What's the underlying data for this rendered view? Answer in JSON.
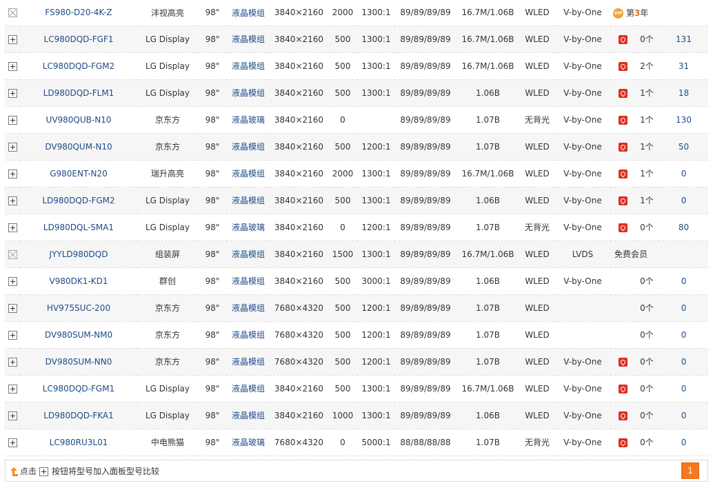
{
  "colors": {
    "link": "#1e4a86",
    "pdf": "#e02d20",
    "accent": "#f47920",
    "vip": "#f1a23a"
  },
  "rows": [
    {
      "toggle": "disabled",
      "model": "FS980-D20-4K-Z",
      "brand": "沣视高亮",
      "size": "98\"",
      "type": "液晶模组",
      "resolution": "3840×2160",
      "brightness": "2000",
      "contrast": "1300:1",
      "angle": "89/89/89/89",
      "colors": "16.7M/1.06B",
      "backlight": "WLED",
      "interface": "V-by-One",
      "pdf": false,
      "vip": true,
      "vip_badge": "VIP",
      "rank_prefix": "第",
      "rank_num": "3",
      "rank_suffix": "年",
      "count": "",
      "link": ""
    },
    {
      "toggle": "plus",
      "model": "LC980DQD-FGF1",
      "brand": "LG Display",
      "size": "98\"",
      "type": "液晶模组",
      "resolution": "3840×2160",
      "brightness": "500",
      "contrast": "1300:1",
      "angle": "89/89/89/89",
      "colors": "16.7M/1.06B",
      "backlight": "WLED",
      "interface": "V-by-One",
      "pdf": true,
      "count": "0个",
      "link": "131"
    },
    {
      "toggle": "plus",
      "model": "LC980DQD-FGM2",
      "brand": "LG Display",
      "size": "98\"",
      "type": "液晶模组",
      "resolution": "3840×2160",
      "brightness": "500",
      "contrast": "1300:1",
      "angle": "89/89/89/89",
      "colors": "16.7M/1.06B",
      "backlight": "WLED",
      "interface": "V-by-One",
      "pdf": true,
      "count": "2个",
      "link": "31"
    },
    {
      "toggle": "plus",
      "model": "LD980DQD-FLM1",
      "brand": "LG Display",
      "size": "98\"",
      "type": "液晶模组",
      "resolution": "3840×2160",
      "brightness": "500",
      "contrast": "1300:1",
      "angle": "89/89/89/89",
      "colors": "1.06B",
      "backlight": "WLED",
      "interface": "V-by-One",
      "pdf": true,
      "count": "1个",
      "link": "18"
    },
    {
      "toggle": "plus",
      "model": "UV980QUB-N10",
      "brand": "京东方",
      "size": "98\"",
      "type": "液晶玻璃",
      "resolution": "3840×2160",
      "brightness": "0",
      "contrast": "",
      "angle": "89/89/89/89",
      "colors": "1.07B",
      "backlight": "无背光",
      "interface": "V-by-One",
      "pdf": true,
      "count": "1个",
      "link": "130"
    },
    {
      "toggle": "plus",
      "model": "DV980QUM-N10",
      "brand": "京东方",
      "size": "98\"",
      "type": "液晶模组",
      "resolution": "3840×2160",
      "brightness": "500",
      "contrast": "1200:1",
      "angle": "89/89/89/89",
      "colors": "1.07B",
      "backlight": "WLED",
      "interface": "V-by-One",
      "pdf": true,
      "count": "1个",
      "link": "50"
    },
    {
      "toggle": "plus",
      "model": "G980ENT-N20",
      "brand": "瑞升高亮",
      "size": "98\"",
      "type": "液晶模组",
      "resolution": "3840×2160",
      "brightness": "2000",
      "contrast": "1300:1",
      "angle": "89/89/89/89",
      "colors": "16.7M/1.06B",
      "backlight": "WLED",
      "interface": "V-by-One",
      "pdf": true,
      "count": "1个",
      "link": "0"
    },
    {
      "toggle": "plus",
      "model": "LD980DQD-FGM2",
      "brand": "LG Display",
      "size": "98\"",
      "type": "液晶模组",
      "resolution": "3840×2160",
      "brightness": "500",
      "contrast": "1300:1",
      "angle": "89/89/89/89",
      "colors": "1.06B",
      "backlight": "WLED",
      "interface": "V-by-One",
      "pdf": true,
      "count": "1个",
      "link": "0"
    },
    {
      "toggle": "plus",
      "model": "LD980DQL-SMA1",
      "brand": "LG Display",
      "size": "98\"",
      "type": "液晶玻璃",
      "resolution": "3840×2160",
      "brightness": "0",
      "contrast": "1200:1",
      "angle": "89/89/89/89",
      "colors": "1.07B",
      "backlight": "无背光",
      "interface": "V-by-One",
      "pdf": true,
      "count": "0个",
      "link": "80"
    },
    {
      "toggle": "disabled",
      "model": "JYYLD980DQD",
      "brand": "组装屏",
      "size": "98\"",
      "type": "液晶模组",
      "resolution": "3840×2160",
      "brightness": "1500",
      "contrast": "1300:1",
      "angle": "89/89/89/89",
      "colors": "16.7M/1.06B",
      "backlight": "WLED",
      "interface": "LVDS",
      "pdf": false,
      "free": "免费会员",
      "count": "",
      "link": ""
    },
    {
      "toggle": "plus",
      "model": "V980DK1-KD1",
      "brand": "群创",
      "size": "98\"",
      "type": "液晶模组",
      "resolution": "3840×2160",
      "brightness": "500",
      "contrast": "3000:1",
      "angle": "89/89/89/89",
      "colors": "1.06B",
      "backlight": "WLED",
      "interface": "V-by-One",
      "pdf": false,
      "count": "0个",
      "link": "0"
    },
    {
      "toggle": "plus",
      "model": "HV975SUC-200",
      "brand": "京东方",
      "size": "98\"",
      "type": "液晶模组",
      "resolution": "7680×4320",
      "brightness": "500",
      "contrast": "1200:1",
      "angle": "89/89/89/89",
      "colors": "1.07B",
      "backlight": "WLED",
      "interface": "",
      "pdf": false,
      "count": "0个",
      "link": "0"
    },
    {
      "toggle": "plus",
      "model": "DV980SUM-NM0",
      "brand": "京东方",
      "size": "98\"",
      "type": "液晶模组",
      "resolution": "7680×4320",
      "brightness": "500",
      "contrast": "1200:1",
      "angle": "89/89/89/89",
      "colors": "1.07B",
      "backlight": "WLED",
      "interface": "",
      "pdf": false,
      "count": "0个",
      "link": "0"
    },
    {
      "toggle": "plus",
      "model": "DV980SUM-NN0",
      "brand": "京东方",
      "size": "98\"",
      "type": "液晶模组",
      "resolution": "7680×4320",
      "brightness": "500",
      "contrast": "1200:1",
      "angle": "89/89/89/89",
      "colors": "1.07B",
      "backlight": "WLED",
      "interface": "V-by-One",
      "pdf": true,
      "count": "0个",
      "link": "0"
    },
    {
      "toggle": "plus",
      "model": "LC980DQD-FGM1",
      "brand": "LG Display",
      "size": "98\"",
      "type": "液晶模组",
      "resolution": "3840×2160",
      "brightness": "500",
      "contrast": "1300:1",
      "angle": "89/89/89/89",
      "colors": "16.7M/1.06B",
      "backlight": "WLED",
      "interface": "V-by-One",
      "pdf": true,
      "count": "0个",
      "link": "0"
    },
    {
      "toggle": "plus",
      "model": "LD980DQD-FKA1",
      "brand": "LG Display",
      "size": "98\"",
      "type": "液晶模组",
      "resolution": "3840×2160",
      "brightness": "1000",
      "contrast": "1300:1",
      "angle": "89/89/89/89",
      "colors": "1.06B",
      "backlight": "WLED",
      "interface": "V-by-One",
      "pdf": true,
      "count": "0个",
      "link": "0"
    },
    {
      "toggle": "plus",
      "model": "LC980RU3L01",
      "brand": "中电熊猫",
      "size": "98\"",
      "type": "液晶玻璃",
      "resolution": "7680×4320",
      "brightness": "0",
      "contrast": "5000:1",
      "angle": "88/88/88/88",
      "colors": "1.07B",
      "backlight": "无背光",
      "interface": "V-by-One",
      "pdf": true,
      "count": "0个",
      "link": "0"
    }
  ],
  "footer": {
    "hint_click": "点击",
    "hint_rest": "按钮将型号加入面板型号比较",
    "page": "1"
  }
}
